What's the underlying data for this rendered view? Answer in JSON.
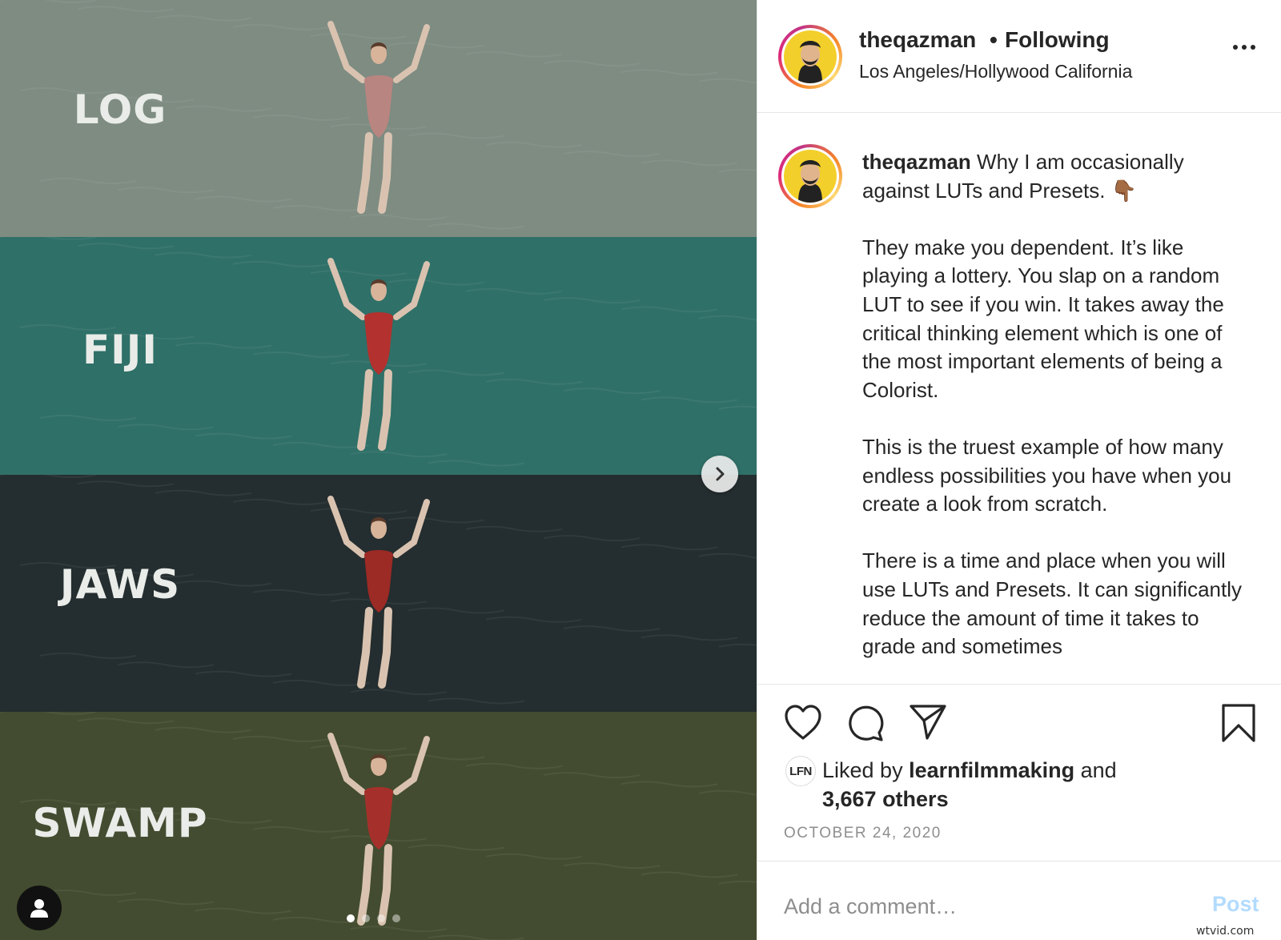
{
  "media": {
    "bands": [
      {
        "label": "LOG",
        "color": "#7e8c82",
        "suit_color": "#b98580"
      },
      {
        "label": "FIJI",
        "color": "#2f7068",
        "suit_color": "#b3312e"
      },
      {
        "label": "JAWS",
        "color": "#242d2f",
        "suit_color": "#9c2a25"
      },
      {
        "label": "SWAMP",
        "color": "#434c30",
        "suit_color": "#a5302b"
      }
    ],
    "next_icon": "chevron-right-icon",
    "user_tag_icon": "user-icon",
    "carousel": {
      "count": 4,
      "active": 1
    }
  },
  "header": {
    "username": "theqazman",
    "separator": "•",
    "follow_status": "Following",
    "location": "Los Angeles/Hollywood California",
    "more_icon": "more-horizontal-icon"
  },
  "caption": {
    "username": "theqazman",
    "first_line": "Why I am occasionally against LUTs and Presets. 👇🏾",
    "paragraphs": [
      "They make you dependent. It’s like playing a lottery. You slap on a random LUT to see if you win. It takes away the critical thinking element which is one of the most important elements of being a Colorist.",
      "This is the truest example of how many endless possibilities you have when you create a look from scratch.",
      "There is a time and place when you will use LUTs and Presets. It can significantly reduce the amount of time it takes to grade and sometimes"
    ]
  },
  "actions": {
    "like_icon": "heart-icon",
    "comment_icon": "comment-icon",
    "share_icon": "paper-plane-icon",
    "save_icon": "bookmark-icon"
  },
  "likes": {
    "logo_text": "LFN",
    "prefix": "Liked by ",
    "liker": "learnfilmmaking",
    "middle": " and",
    "others": "3,667 others"
  },
  "date": "OCTOBER 24, 2020",
  "comment": {
    "placeholder": "Add a comment…",
    "post_label": "Post"
  },
  "watermark": "wtvid.com"
}
